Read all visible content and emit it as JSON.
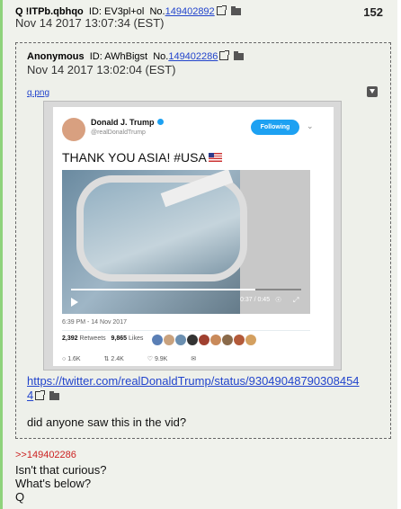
{
  "post": {
    "name": "Q",
    "tripcode": "!ITPb.qbhqo",
    "id_label": "ID: EV3pl+ol",
    "no_prefix": "No.",
    "number": "149402892",
    "date": "Nov 14 2017 13:07:34 (EST)",
    "reply_count": "152",
    "reply_link": ">>149402286",
    "lines": [
      "Isn't that curious?",
      "What's below?",
      "Q"
    ]
  },
  "quoted": {
    "name": "Anonymous",
    "id_label": "ID: AWhBigst",
    "no_prefix": "No.",
    "number": "149402286",
    "date": "Nov 14 2017 13:02:04 (EST)",
    "filename": "q.png",
    "url_line1": "https://twitter.com/realDonaldTrump/status/93049048790308454",
    "url_line2": "4",
    "message": "did anyone saw this in the vid?"
  },
  "tweet": {
    "author": "Donald J. Trump",
    "handle": "@realDonaldTrump",
    "follow_label": "Following",
    "text": "THANK YOU ASIA! #USA",
    "video_time": "0:37 / 0:45",
    "video_progress": 0.8,
    "timestamp": "6:39 PM - 14 Nov 2017",
    "retweets": "2,392",
    "retweets_label": "Retweets",
    "likes": "9,865",
    "likes_label": "Likes",
    "reply_count": "1.6K",
    "retweet_count": "2.4K",
    "like_count": "9.9K",
    "face_colors": [
      "#5a7fb5",
      "#c9a27e",
      "#6b8fb0",
      "#333333",
      "#a04030",
      "#c98a5a",
      "#8a6a4a",
      "#b35a3a",
      "#d4a060"
    ]
  }
}
